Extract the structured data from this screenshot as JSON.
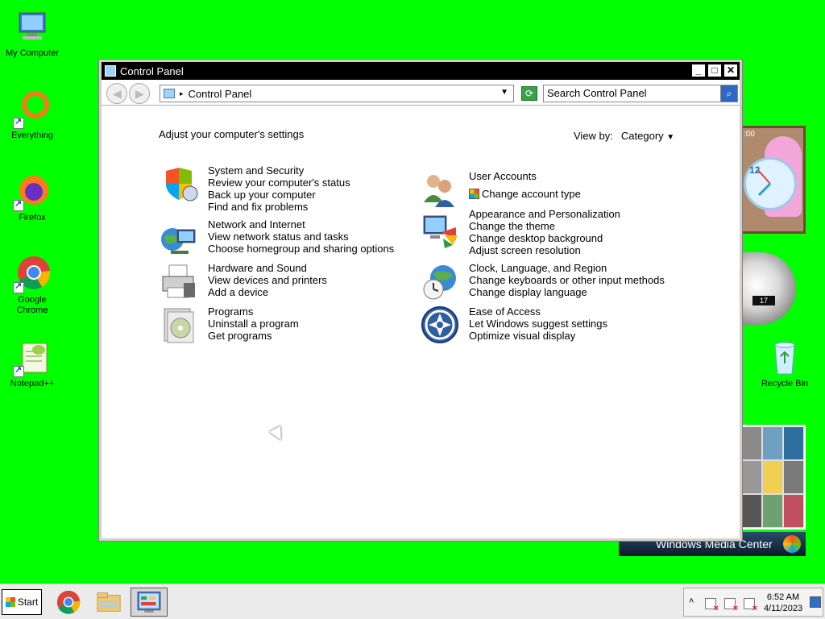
{
  "desktop": {
    "icons": [
      {
        "label": "My Computer",
        "icon": "computer-icon"
      },
      {
        "label": "Everything",
        "icon": "everything-icon"
      },
      {
        "label": "Firefox",
        "icon": "firefox-icon"
      },
      {
        "label": "Google Chrome",
        "icon": "chrome-icon"
      },
      {
        "label": "Notepad++",
        "icon": "notepad-plus-plus-icon"
      },
      {
        "label": "Recycle Bin",
        "icon": "recycle-bin-icon"
      }
    ],
    "gadgets": {
      "clock_time_fragment": ":00",
      "clock_number": "12",
      "gauge_readout": "17",
      "media_center_label": "Windows Media Center"
    },
    "background_color": "#00ff00"
  },
  "window": {
    "title": "Control Panel",
    "controls": {
      "minimize": "_",
      "maximize": "□",
      "close": "✕"
    },
    "address": {
      "path": "Control Panel"
    },
    "search": {
      "placeholder": "Search Control Panel"
    },
    "heading": "Adjust your computer's settings",
    "view_by": {
      "label": "View by:",
      "value": "Category"
    },
    "categories_left": [
      {
        "title": "System and Security",
        "links": [
          "Review your computer's status",
          "Back up your computer",
          "Find and fix problems"
        ],
        "icon": "shield-icon"
      },
      {
        "title": "Network and Internet",
        "links": [
          "View network status and tasks",
          "Choose homegroup and sharing options"
        ],
        "icon": "network-globe-icon"
      },
      {
        "title": "Hardware and Sound",
        "links": [
          "View devices and printers",
          "Add a device"
        ],
        "icon": "printer-icon"
      },
      {
        "title": "Programs",
        "links": [
          "Uninstall a program",
          "Get programs"
        ],
        "icon": "programs-disc-icon"
      }
    ],
    "categories_right": [
      {
        "title": "User Accounts",
        "links": [
          "Change account type"
        ],
        "icon": "users-icon"
      },
      {
        "title": "Appearance and Personalization",
        "links": [
          "Change the theme",
          "Change desktop background",
          "Adjust screen resolution"
        ],
        "icon": "monitor-paint-icon"
      },
      {
        "title": "Clock, Language, and Region",
        "links": [
          "Change keyboards or other input methods",
          "Change display language"
        ],
        "icon": "globe-clock-icon"
      },
      {
        "title": "Ease of Access",
        "links": [
          "Let Windows suggest settings",
          "Optimize visual display"
        ],
        "icon": "ease-of-access-icon"
      }
    ]
  },
  "taskbar": {
    "start_label": "Start",
    "pinned": [
      "chrome-icon",
      "explorer-icon",
      "control-panel-icon"
    ],
    "clock": {
      "time": "6:52 AM",
      "date": "4/11/2023"
    }
  }
}
